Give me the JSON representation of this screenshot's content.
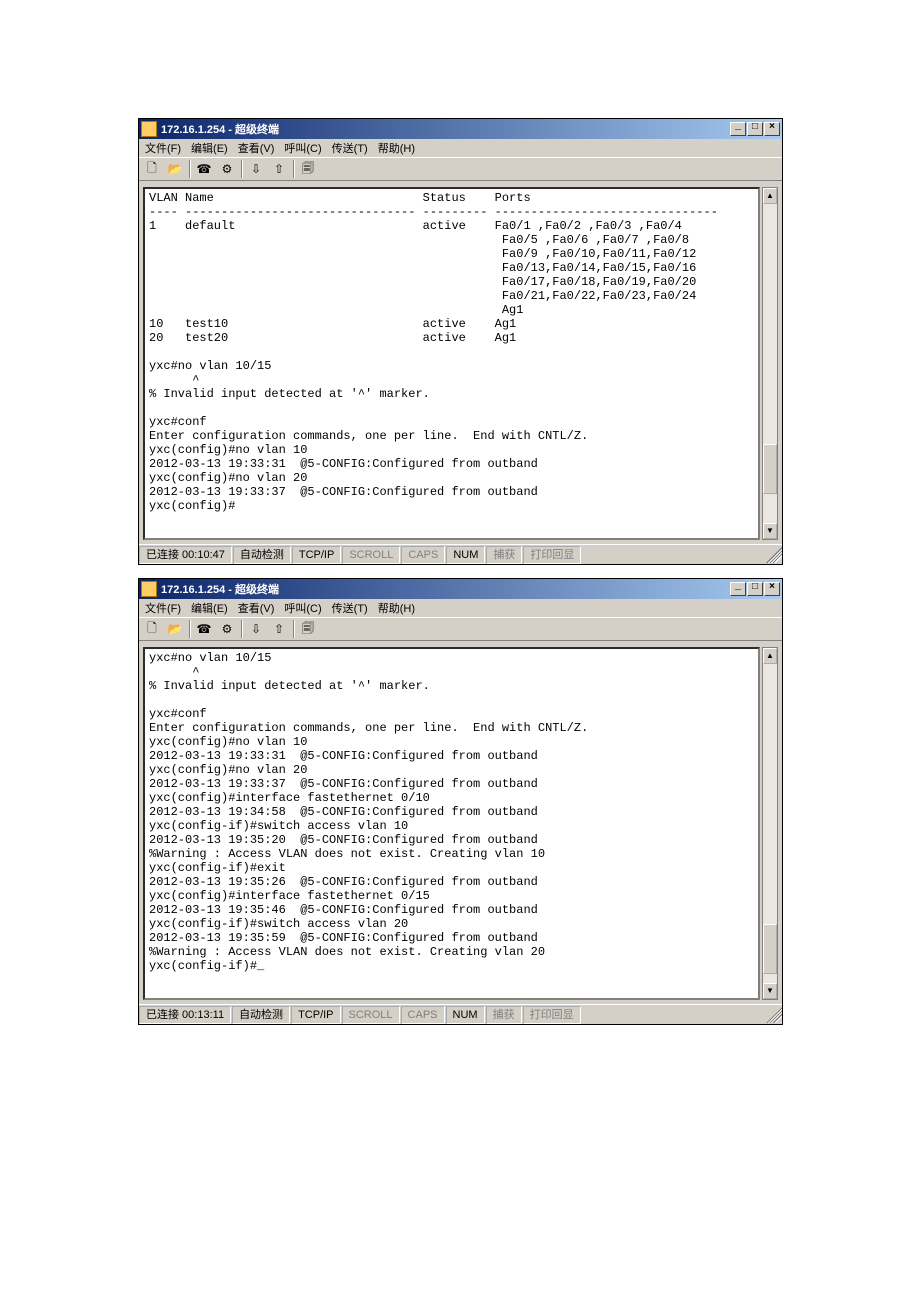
{
  "window1": {
    "title": "172.16.1.254 - 超级终端",
    "menus": {
      "file": "文件(F)",
      "edit": "编辑(E)",
      "view": "查看(V)",
      "call": "呼叫(C)",
      "transfer": "传送(T)",
      "help": "帮助(H)"
    },
    "terminal": "VLAN Name                             Status    Ports\n---- -------------------------------- --------- -------------------------------\n1    default                          active    Fa0/1 ,Fa0/2 ,Fa0/3 ,Fa0/4\n                                                 Fa0/5 ,Fa0/6 ,Fa0/7 ,Fa0/8\n                                                 Fa0/9 ,Fa0/10,Fa0/11,Fa0/12\n                                                 Fa0/13,Fa0/14,Fa0/15,Fa0/16\n                                                 Fa0/17,Fa0/18,Fa0/19,Fa0/20\n                                                 Fa0/21,Fa0/22,Fa0/23,Fa0/24\n                                                 Ag1\n10   test10                           active    Ag1\n20   test20                           active    Ag1\n\nyxc#no vlan 10/15\n      ^\n% Invalid input detected at '^' marker.\n\nyxc#conf\nEnter configuration commands, one per line.  End with CNTL/Z.\nyxc(config)#no vlan 10\n2012-03-13 19:33:31  @5-CONFIG:Configured from outband\nyxc(config)#no vlan 20\n2012-03-13 19:33:37  @5-CONFIG:Configured from outband\nyxc(config)#",
    "status": {
      "connected": "已连接 00:10:47",
      "auto": "自动检测",
      "proto": "TCP/IP",
      "scroll": "SCROLL",
      "caps": "CAPS",
      "num": "NUM",
      "capture": "捕获",
      "printecho": "打印回显"
    }
  },
  "window2": {
    "title": "172.16.1.254 - 超级终端",
    "menus": {
      "file": "文件(F)",
      "edit": "编辑(E)",
      "view": "查看(V)",
      "call": "呼叫(C)",
      "transfer": "传送(T)",
      "help": "帮助(H)"
    },
    "terminal": "yxc#no vlan 10/15\n      ^\n% Invalid input detected at '^' marker.\n\nyxc#conf\nEnter configuration commands, one per line.  End with CNTL/Z.\nyxc(config)#no vlan 10\n2012-03-13 19:33:31  @5-CONFIG:Configured from outband\nyxc(config)#no vlan 20\n2012-03-13 19:33:37  @5-CONFIG:Configured from outband\nyxc(config)#interface fastethernet 0/10\n2012-03-13 19:34:58  @5-CONFIG:Configured from outband\nyxc(config-if)#switch access vlan 10\n2012-03-13 19:35:20  @5-CONFIG:Configured from outband\n%Warning : Access VLAN does not exist. Creating vlan 10\nyxc(config-if)#exit\n2012-03-13 19:35:26  @5-CONFIG:Configured from outband\nyxc(config)#interface fastethernet 0/15\n2012-03-13 19:35:46  @5-CONFIG:Configured from outband\nyxc(config-if)#switch access vlan 20\n2012-03-13 19:35:59  @5-CONFIG:Configured from outband\n%Warning : Access VLAN does not exist. Creating vlan 20\nyxc(config-if)#_",
    "status": {
      "connected": "已连接 00:13:11",
      "auto": "自动检测",
      "proto": "TCP/IP",
      "scroll": "SCROLL",
      "caps": "CAPS",
      "num": "NUM",
      "capture": "捕获",
      "printecho": "打印回显"
    }
  },
  "winbtns": {
    "min": "_",
    "max": "□",
    "close": "×"
  }
}
